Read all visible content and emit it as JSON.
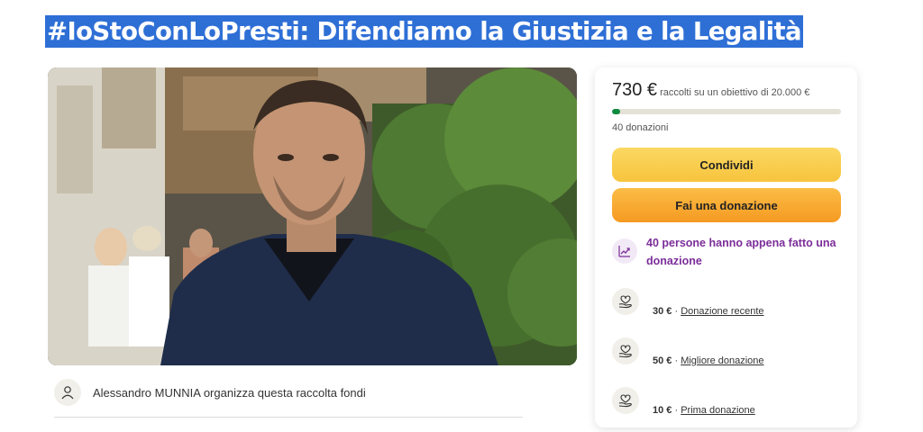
{
  "page": {
    "title": "#IoStoConLoPresti: Difendiamo la Giustizia e la Legalità"
  },
  "hero": {
    "image_desc": "organizer-photo"
  },
  "organizer": {
    "text": "Alessandro MUNNIA organizza questa raccolta fondi"
  },
  "stats": {
    "raised": "730 €",
    "goal_text": "raccolti su un obiettivo di 20.000 €",
    "progress_fraction": 0.0365,
    "donations_count": "40 donazioni"
  },
  "actions": {
    "share": "Condividi",
    "donate": "Fai una donazione"
  },
  "notice": {
    "text": "40 persone hanno appena fatto una donazione"
  },
  "donations": [
    {
      "amount": "30 €",
      "label": "Donazione recente"
    },
    {
      "amount": "50 €",
      "label": "Migliore donazione"
    },
    {
      "amount": "10 €",
      "label": "Prima donazione"
    }
  ],
  "colors": {
    "accent_green": "#0f8b3f",
    "share_yellow": "#f7c43d",
    "donate_orange": "#f59a22",
    "notice_purple": "#7b2d99",
    "title_highlight": "#2e6fd6"
  }
}
